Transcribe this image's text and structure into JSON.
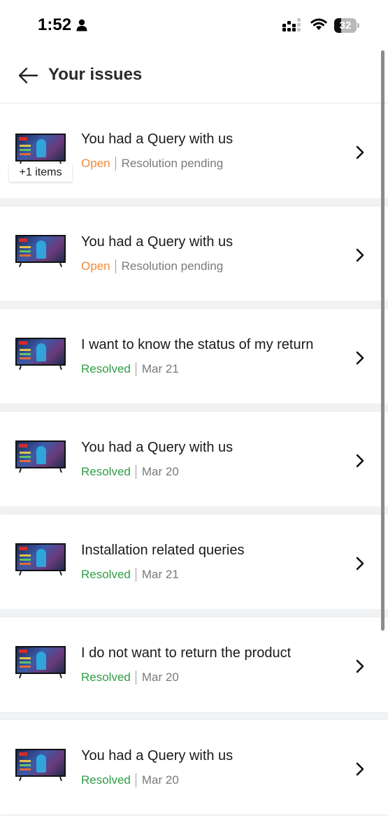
{
  "status_bar": {
    "time": "1:52",
    "battery": "32",
    "battery_level": 0.32
  },
  "header": {
    "title": "Your issues"
  },
  "issues": [
    {
      "title": "You had a Query with us",
      "status": "Open",
      "detail": "Resolution pending",
      "badge": "+1 items"
    },
    {
      "title": "You had a Query with us",
      "status": "Open",
      "detail": "Resolution pending"
    },
    {
      "title": "I want to know the status of my return",
      "status": "Resolved",
      "detail": "Mar 21"
    },
    {
      "title": "You had a Query with us",
      "status": "Resolved",
      "detail": "Mar 20"
    },
    {
      "title": "Installation related queries",
      "status": "Resolved",
      "detail": "Mar 21"
    },
    {
      "title": "I do not want to return the product",
      "status": "Resolved",
      "detail": "Mar 20"
    },
    {
      "title": "You had a Query with us",
      "status": "Resolved",
      "detail": "Mar 20"
    }
  ],
  "colors": {
    "open": "#f08a3a",
    "resolved": "#2f9e44",
    "detail": "#7a7a7a"
  },
  "icons": {
    "back": "arrow-left-icon",
    "chevron": "chevron-right-icon",
    "thumbnail": "tv-product-thumbnail"
  }
}
